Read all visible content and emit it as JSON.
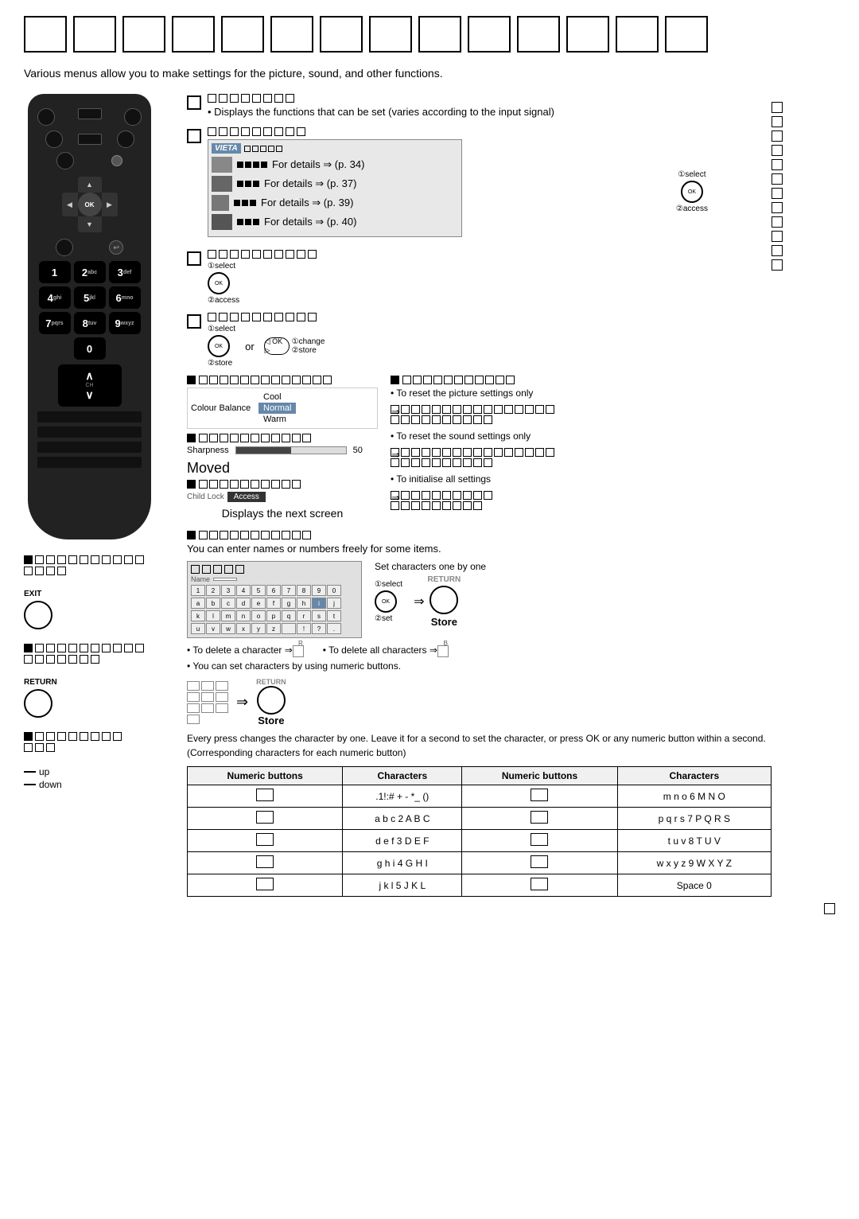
{
  "header": {
    "squares_count": 14,
    "intro": "Various menus allow you to make settings for the picture, sound, and other functions."
  },
  "sections": {
    "picture_menu": {
      "label_squares": 8,
      "bullet": "Displays the functions that can be set (varies according to the input signal)"
    },
    "sound_menu": {
      "label_squares": 9
    },
    "timer_menu": {
      "label_squares": 8
    },
    "setup_menu": {
      "label_squares": 8
    },
    "details": [
      {
        "page": "p. 34"
      },
      {
        "page": "p. 37"
      },
      {
        "page": "p. 39"
      },
      {
        "page": "p. 40"
      }
    ],
    "select_label": "①select",
    "access_label": "②access",
    "store_label": "②store",
    "change_label": "①change",
    "or_label": "or"
  },
  "colour_balance": {
    "label": "Colour Balance",
    "options": [
      "Cool",
      "Normal",
      "Warm"
    ],
    "selected": "Normal"
  },
  "sharpness": {
    "label": "Sharpness",
    "value": 50,
    "max": 100
  },
  "moved": {
    "text": "Moved"
  },
  "child_lock": {
    "label": "Child Lock",
    "value": "Access"
  },
  "displays_next": "Displays the next screen",
  "name_entry": {
    "title": "You can enter names or numbers freely for some items.",
    "set_label": "Set characters one by one",
    "select_label": "①select",
    "set_action": "②set",
    "store": "Store",
    "delete_char": "To delete a character",
    "delete_all": "To delete all characters",
    "numeric_note": "You can set characters by using numeric buttons.",
    "store2": "Store",
    "every_press": "Every press changes the character by one. Leave it for a second to set the character, or press OK or any numeric button within a second.",
    "corresponding": "(Corresponding characters for each numeric button)",
    "name_field_label": "Name"
  },
  "table": {
    "col1": "Numeric buttons",
    "col2": "Characters",
    "col3": "Numeric buttons",
    "col4": "Characters",
    "rows": [
      {
        "chars_left": ".1!:# + - *_  ()",
        "chars_right": "m n o 6 M N O"
      },
      {
        "chars_left": "a b c 2 A B C",
        "chars_right": "p q r s 7 P Q R S"
      },
      {
        "chars_left": "d e f 3 D E F",
        "chars_right": "t u v 8 T U V"
      },
      {
        "chars_left": "g h i 4 G H I",
        "chars_right": "w x y z 9 W X Y Z"
      },
      {
        "chars_left": "j k l 5 J K L",
        "chars_right": "Space 0"
      }
    ]
  },
  "sidebar_left": {
    "exit_label": "EXIT",
    "return_label": "RETURN",
    "up_label": "up",
    "down_label": "down"
  },
  "reset_section": {
    "picture_only": "To reset the picture settings only",
    "sound_only": "To reset the sound settings only",
    "initialise": "To initialise all settings"
  }
}
